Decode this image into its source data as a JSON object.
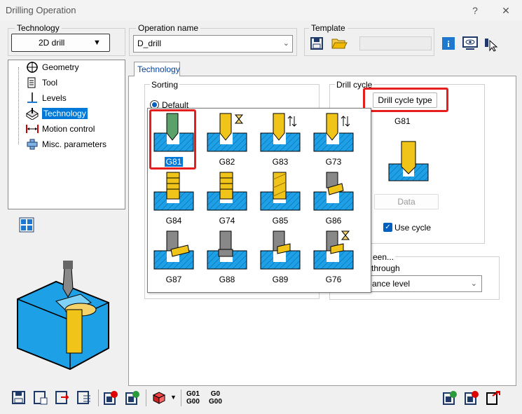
{
  "window": {
    "title": "Drilling Operation",
    "help_label": "?",
    "close_label": "✕"
  },
  "technology_group": {
    "label": "Technology",
    "value": "2D drill"
  },
  "operation_group": {
    "label": "Operation name",
    "value": "D_drill"
  },
  "template_group": {
    "label": "Template"
  },
  "tree": {
    "items": [
      {
        "label": "Geometry",
        "icon": "crosshair-icon"
      },
      {
        "label": "Tool",
        "icon": "tool-icon"
      },
      {
        "label": "Levels",
        "icon": "levels-icon"
      },
      {
        "label": "Technology",
        "icon": "technology-icon",
        "selected": true
      },
      {
        "label": "Motion control",
        "icon": "motion-icon"
      },
      {
        "label": "Misc. parameters",
        "icon": "misc-icon"
      }
    ]
  },
  "tab": {
    "label": "Technology"
  },
  "sorting": {
    "label": "Sorting",
    "default_label": "Default"
  },
  "drill_cycle": {
    "label": "Drill cycle",
    "button_label": "Drill cycle type",
    "current": "G81",
    "data_label": "Data",
    "use_cycle_label": "Use cycle"
  },
  "between": {
    "label": "een...",
    "through_label": "through",
    "level_value": "ance level"
  },
  "cycles": [
    {
      "code": "G81",
      "selected": true
    },
    {
      "code": "G82"
    },
    {
      "code": "G83"
    },
    {
      "code": "G73"
    },
    {
      "code": "G84"
    },
    {
      "code": "G74"
    },
    {
      "code": "G85"
    },
    {
      "code": "G86"
    },
    {
      "code": "G87"
    },
    {
      "code": "G88"
    },
    {
      "code": "G89"
    },
    {
      "code": "G76"
    }
  ],
  "bottom_toolbar": {
    "g01_label": "G01",
    "g00_label": "G00",
    "g0_label": "G0",
    "g00b_label": "G00"
  },
  "colors": {
    "accent": "#0078d7",
    "highlight": "#e61e1e",
    "water": "#1ea0e6",
    "drill": "#f0c419"
  }
}
